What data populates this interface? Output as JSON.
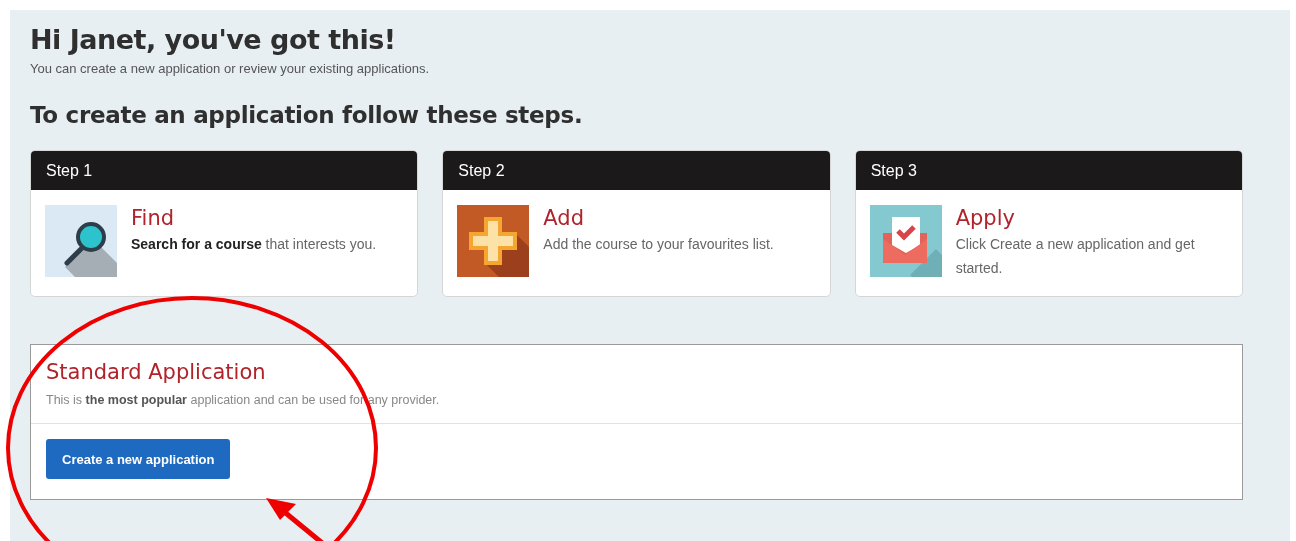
{
  "greeting": {
    "title": "Hi Janet, you've got this!",
    "subtitle": "You can create a new application or review your existing applications."
  },
  "steps_heading": "To create an application follow these steps.",
  "steps": [
    {
      "header": "Step 1",
      "kind": "find",
      "title": "Find",
      "description": "**Search for a course** that interests you."
    },
    {
      "header": "Step 2",
      "kind": "add",
      "title": "Add",
      "description": "Add the course to your favourites list."
    },
    {
      "header": "Step 3",
      "kind": "apply",
      "title": "Apply",
      "description": "Click Create a new application and get started."
    }
  ],
  "application": {
    "title": "Standard Application",
    "description": "This is **the most popular** application and can be used for any provider.",
    "button": "Create a new application"
  }
}
